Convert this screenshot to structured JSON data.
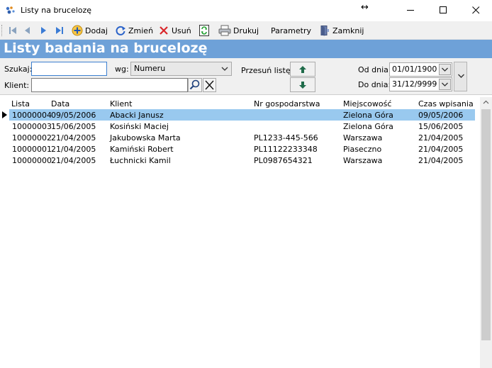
{
  "window": {
    "title": "Listy na brucelozę"
  },
  "toolbar": {
    "add_label": "Dodaj",
    "edit_label": "Zmień",
    "delete_label": "Usuń",
    "print_label": "Drukuj",
    "params_label": "Parametry",
    "close_label": "Zamknij"
  },
  "header": {
    "title": "Listy badania na brucelozę"
  },
  "filters": {
    "search_label": "Szukaj:",
    "search_value": "",
    "by_label": "wg:",
    "by_value": "Numeru",
    "client_label": "Klient:",
    "client_value": "",
    "shift_label": "Przesuń listę:",
    "from_label": "Od dnia:",
    "from_value": "01/01/1900",
    "to_label": "Do dnia:",
    "to_value": "31/12/9999"
  },
  "grid": {
    "columns": [
      "Lista",
      "Data",
      "Klient",
      "Nr gospodarstwa",
      "Miejscowość",
      "Czas wpisania"
    ],
    "rows": [
      [
        "10000004",
        "09/05/2006",
        "Abacki Janusz",
        "",
        "Zielona Góra",
        "09/05/2006"
      ],
      [
        "10000003",
        "15/06/2005",
        "Kosiński Maciej",
        "",
        "Zielona Góra",
        "15/06/2005"
      ],
      [
        "10000002",
        "21/04/2005",
        "Jakubowska Marta",
        "PL1233-445-566",
        "Warszawa",
        "21/04/2005"
      ],
      [
        "10000001",
        "21/04/2005",
        "Kamiński Robert",
        "PL11122233348",
        "Piaseczno",
        "21/04/2005"
      ],
      [
        "10000000",
        "21/04/2005",
        "Łuchnicki Kamil",
        "PL0987654321",
        "Warszawa",
        "21/04/2005"
      ]
    ],
    "selected_row": 0
  },
  "colors": {
    "header_band": "#6ea1d8",
    "selected_row": "#99c9ef"
  }
}
